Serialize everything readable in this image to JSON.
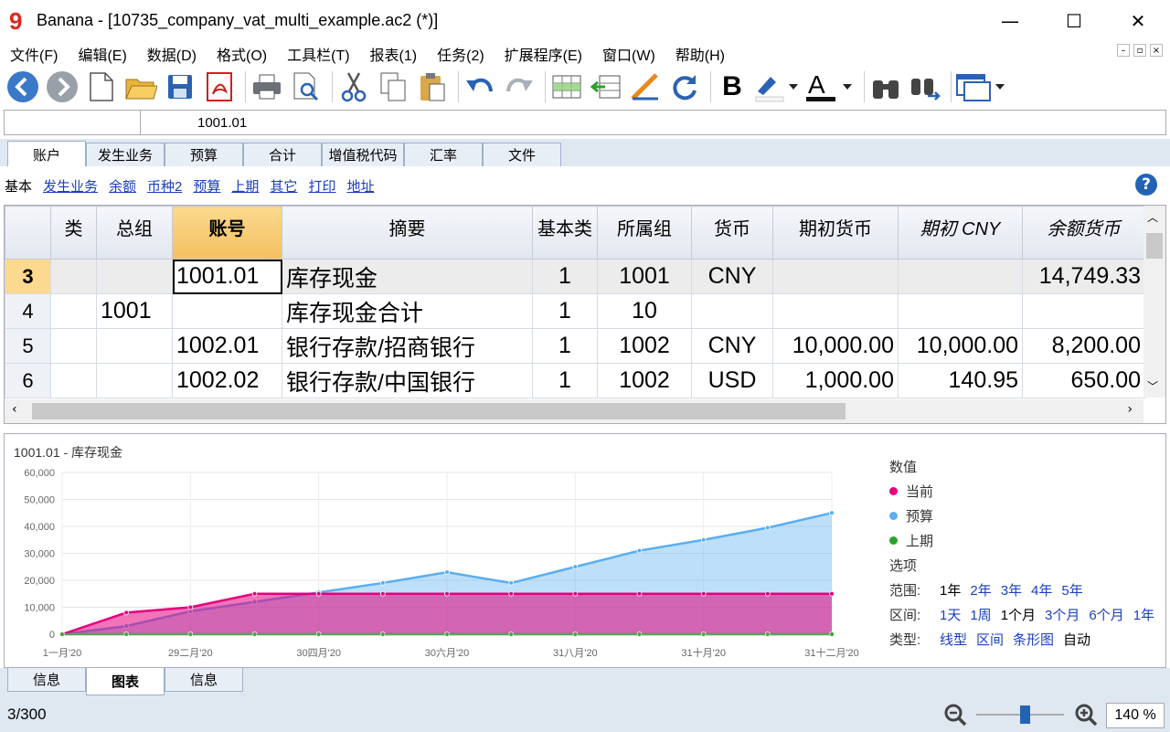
{
  "window": {
    "title": "Banana - [10735_company_vat_multi_example.ac2 (*)]",
    "minimize": "—",
    "maximize": "☐",
    "close": "✕"
  },
  "menu": [
    "文件(F)",
    "编辑(E)",
    "数据(D)",
    "格式(O)",
    "工具栏(T)",
    "报表(1)",
    "任务(2)",
    "扩展程序(E)",
    "窗口(W)",
    "帮助(H)"
  ],
  "cell": {
    "ref": "",
    "value": "1001.01"
  },
  "tabs": [
    "账户",
    "发生业务",
    "预算",
    "合计",
    "增值税代码",
    "汇率",
    "文件"
  ],
  "views": {
    "active": "基本",
    "links": [
      "发生业务",
      "余额",
      "币种2",
      "预算",
      "上期",
      "其它",
      "打印",
      "地址"
    ]
  },
  "table": {
    "headers": [
      "",
      "类",
      "总组",
      "账号",
      "摘要",
      "基本类",
      "所属组",
      "货币",
      "期初货币",
      "期初 CNY",
      "余额货币"
    ],
    "rows": [
      [
        "3",
        "",
        "",
        "1001.01",
        "库存现金",
        "1",
        "1001",
        "CNY",
        "",
        "",
        "14,749.33"
      ],
      [
        "4",
        "",
        "1001",
        "",
        "库存现金合计",
        "1",
        "10",
        "",
        "",
        "",
        ""
      ],
      [
        "5",
        "",
        "",
        "1002.01",
        "银行存款/招商银行",
        "1",
        "1002",
        "CNY",
        "10,000.00",
        "10,000.00",
        "8,200.00"
      ],
      [
        "6",
        "",
        "",
        "1002.02",
        "银行存款/中国银行",
        "1",
        "1002",
        "USD",
        "1,000.00",
        "140.95",
        "650.00"
      ]
    ]
  },
  "chart_data": {
    "type": "area",
    "title": "1001.01 - 库存现金",
    "x_ticks": [
      "1一月'20",
      "29二月'20",
      "30四月'20",
      "30六月'20",
      "31八月'20",
      "31十月'20",
      "31十二月'20"
    ],
    "y_ticks": [
      "0",
      "10,000",
      "20,000",
      "30,000",
      "40,000",
      "50,000",
      "60,000"
    ],
    "ylim": [
      0,
      60000
    ],
    "series": [
      {
        "name": "当前",
        "color": "#e5007d",
        "values": [
          0,
          8000,
          10000,
          15000,
          15000,
          15000,
          15000,
          15000,
          15000,
          15000,
          15000,
          15000,
          15000
        ]
      },
      {
        "name": "预算",
        "color": "#5aaef0",
        "values": [
          0,
          3000,
          8500,
          12000,
          15500,
          19000,
          23000,
          19000,
          25000,
          31000,
          35000,
          39500,
          45000
        ]
      },
      {
        "name": "上期",
        "color": "#2ca02c",
        "values": [
          0,
          0,
          0,
          0,
          0,
          0,
          0,
          0,
          0,
          0,
          0,
          0,
          0
        ]
      }
    ]
  },
  "legend": {
    "heading": "数值",
    "options_heading": "选项",
    "range_label": "范围:",
    "range": [
      "1年",
      "2年",
      "3年",
      "4年",
      "5年"
    ],
    "interval_label": "区间:",
    "interval": [
      "1天",
      "1周",
      "1个月",
      "3个月",
      "6个月",
      "1年"
    ],
    "interval_active": "1个月",
    "type_label": "类型:",
    "types": [
      "线型",
      "区间",
      "条形图",
      "自动"
    ],
    "type_active": "自动"
  },
  "bottom_tabs": [
    "信息",
    "图表",
    "信息"
  ],
  "status": {
    "rows": "3/300",
    "zoom": "140 %"
  }
}
